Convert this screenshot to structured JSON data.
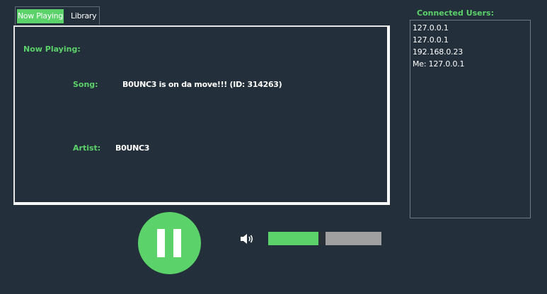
{
  "tabs": {
    "now_playing": "Now Playing",
    "library": "Library"
  },
  "now_playing": {
    "heading": "Now Playing:",
    "song_label": "Song:",
    "song_value": "B0UNC3 is on da move!!! (ID: 314263)",
    "artist_label": "Artist:",
    "artist_value": "B0UNC3"
  },
  "users": {
    "title": "Connected Users:",
    "items": [
      "127.0.0.1",
      "127.0.0.1",
      "192.168.0.23",
      "Me: 127.0.0.1"
    ]
  },
  "controls": {
    "play_state_icon": "pause-icon",
    "volume_icon": "speaker-icon",
    "volume_level": 0.47
  },
  "colors": {
    "background": "#232f3a",
    "accent": "#5bd26a",
    "text": "#ffffff",
    "slider_track": "#a0a0a0"
  }
}
